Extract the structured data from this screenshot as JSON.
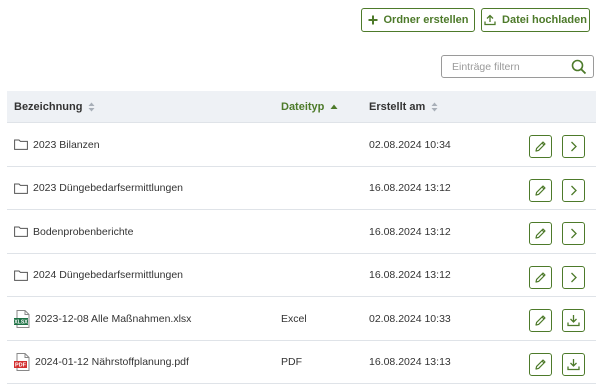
{
  "toolbar": {
    "create_folder_label": "Ordner erstellen",
    "upload_file_label": "Datei hochladen"
  },
  "filter": {
    "placeholder": "Einträge filtern",
    "value": ""
  },
  "table": {
    "columns": [
      {
        "label": "Bezeichnung",
        "sort": "none"
      },
      {
        "label": "Dateityp",
        "sort": "ascending"
      },
      {
        "label": "Erstellt am",
        "sort": "none"
      }
    ],
    "rows": [
      {
        "kind": "folder",
        "name": "2023 Bilanzen",
        "type": "",
        "created": "02.08.2024 10:34",
        "action": "open"
      },
      {
        "kind": "folder",
        "name": "2023 Düngebedarfsermittlungen",
        "type": "",
        "created": "16.08.2024 13:12",
        "action": "open"
      },
      {
        "kind": "folder",
        "name": "Bodenprobenberichte",
        "type": "",
        "created": "16.08.2024 13:12",
        "action": "open"
      },
      {
        "kind": "folder",
        "name": "2024 Düngebedarfsermittlungen",
        "type": "",
        "created": "16.08.2024 13:12",
        "action": "open"
      },
      {
        "kind": "xlsx",
        "name": "2023-12-08 Alle Maßnahmen.xlsx",
        "type": "Excel",
        "created": "02.08.2024 10:33",
        "action": "download"
      },
      {
        "kind": "pdf",
        "name": "2024-01-12 Nährstoffplanung.pdf",
        "type": "PDF",
        "created": "16.08.2024 13:13",
        "action": "download"
      }
    ]
  },
  "icons": {
    "xlsx_badge": "XLSX",
    "pdf_badge": "PDF"
  },
  "colors": {
    "accent": "#4d7a2a",
    "header_bg": "#eef1f5",
    "border": "#dfe3e8",
    "excel": "#1e7145",
    "pdf": "#d32f2f"
  }
}
